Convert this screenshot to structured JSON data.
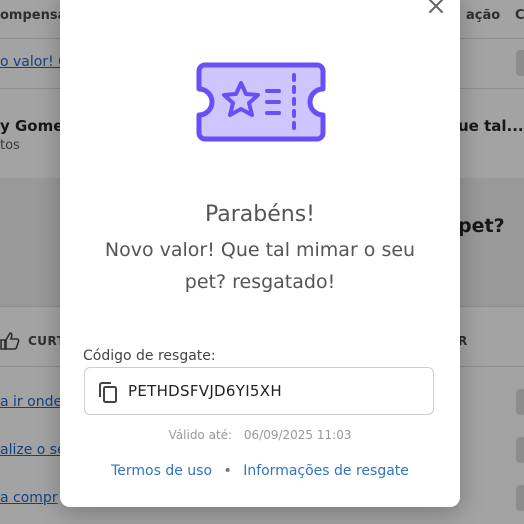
{
  "background": {
    "header_left": "ompensa",
    "header_right_1": "ação",
    "header_right_2": "C",
    "link_top": "o valor! Q",
    "person_name": "y Gomes",
    "person_sub": "tos",
    "right_heading": "ue tal...",
    "pet_text": "pet?",
    "curtir_label": "CURT",
    "r_label": "R",
    "link_1": "a ir onde",
    "link_2": "alize o se",
    "link_3": "a compr"
  },
  "modal": {
    "close_icon": "close-icon",
    "ticket_icon": "ticket-star-icon",
    "title": "Parabéns!",
    "message": "Novo valor! Que tal mimar o seu pet? resgatado!",
    "code_label": "Código de resgate:",
    "copy_icon": "copy-icon",
    "code_value": "PETHDSFVJD6YI5XH",
    "valid_label": "Válido até:",
    "valid_date": "06/09/2025 11:03",
    "terms_link": "Termos de uso",
    "separator": "•",
    "info_link": "Informações de resgate"
  },
  "colors": {
    "accent_purple": "#6b4ff6",
    "ticket_fill": "#cfc6ff",
    "link_blue": "#2f74c0"
  }
}
